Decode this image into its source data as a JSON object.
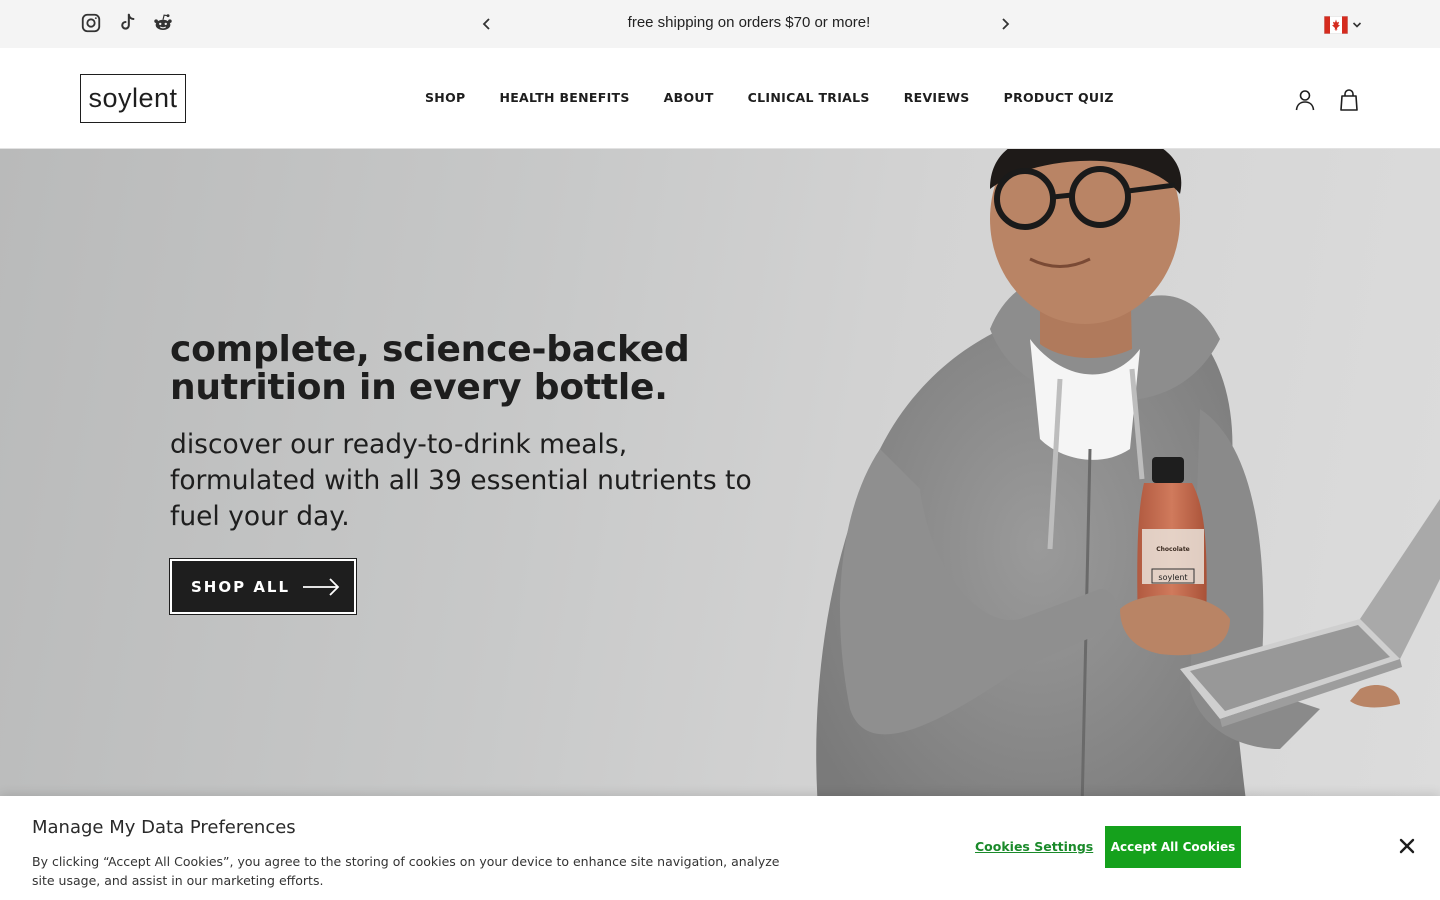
{
  "announcement": {
    "text": "free shipping on orders $70 or more!",
    "prev_icon": "chevron-left-icon",
    "next_icon": "chevron-right-icon"
  },
  "social": [
    {
      "name": "instagram",
      "icon": "instagram-icon"
    },
    {
      "name": "tiktok",
      "icon": "tiktok-icon"
    },
    {
      "name": "reddit",
      "icon": "reddit-icon"
    }
  ],
  "country_selector": {
    "flag": "canada-flag-icon",
    "icon": "chevron-down-icon"
  },
  "header": {
    "logo": "soylent",
    "nav": [
      {
        "label": "SHOP"
      },
      {
        "label": "HEALTH BENEFITS"
      },
      {
        "label": "ABOUT"
      },
      {
        "label": "CLINICAL TRIALS"
      },
      {
        "label": "REVIEWS"
      },
      {
        "label": "PRODUCT QUIZ"
      }
    ],
    "account_icon": "account-icon",
    "bag_icon": "shopping-bag-icon"
  },
  "hero": {
    "title": "complete, science-backed nutrition in every bottle.",
    "subtitle": "discover our ready-to-drink meals, formulated with all 39 essential nutrients to fuel your day.",
    "cta_label": "SHOP ALL",
    "cta_icon": "arrow-right-icon",
    "bottle_label": "soylent",
    "bottle_flavor": "Chocolate"
  },
  "cookie_banner": {
    "title": "Manage My Data Preferences",
    "text": "By clicking “Accept All Cookies”, you agree to the storing of cookies on your device to enhance site navigation, analyze site usage, and assist in our marketing efforts.",
    "settings_label": "Cookies Settings",
    "accept_label": "Accept All Cookies",
    "close_icon": "close-icon"
  },
  "colors": {
    "brand_dark": "#1e1e1e",
    "announcement_bg": "#f4f4f4",
    "accept_green": "#15a11c",
    "settings_green": "#1a8a2a"
  }
}
